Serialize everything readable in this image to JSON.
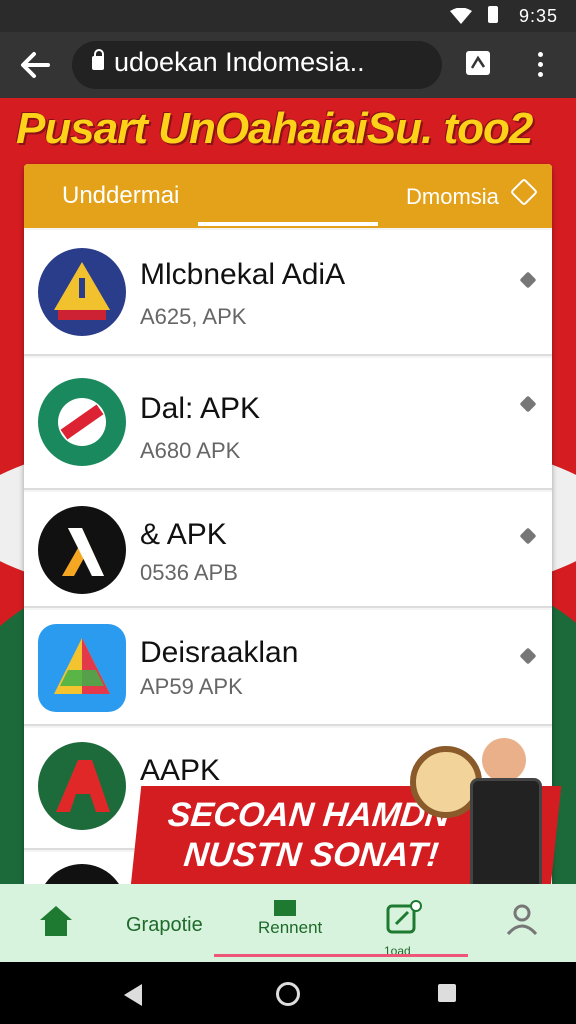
{
  "status": {
    "time": "9:35"
  },
  "browser": {
    "url": "udoekan Indomesia.."
  },
  "page": {
    "headline": "Pusart UnOahaiaiSu. too2",
    "tabs": {
      "active": "Unddermai",
      "right": "Dmomsia"
    }
  },
  "apps": [
    {
      "name": "Mlcbnekal AdiA",
      "sub": "A625, APK"
    },
    {
      "name": "Dal: APK",
      "sub": "A680 APK"
    },
    {
      "name": "& APK",
      "sub": "0536 APB"
    },
    {
      "name": "Deisraaklan",
      "sub": "AP59 APK"
    },
    {
      "name": "AAPK",
      "sub": ""
    }
  ],
  "promo": {
    "line1": "SECOAN HAMDN",
    "line2": "NUSTN SONAT!"
  },
  "nav": {
    "items": [
      {
        "label": ""
      },
      {
        "label": "Grapotie"
      },
      {
        "label": "Rennent"
      },
      {
        "label": "1oad"
      },
      {
        "label": ""
      }
    ]
  },
  "colors": {
    "accent_red": "#d51d21",
    "tab_gold": "#e3a21a",
    "nav_green": "#1e6a2a"
  }
}
